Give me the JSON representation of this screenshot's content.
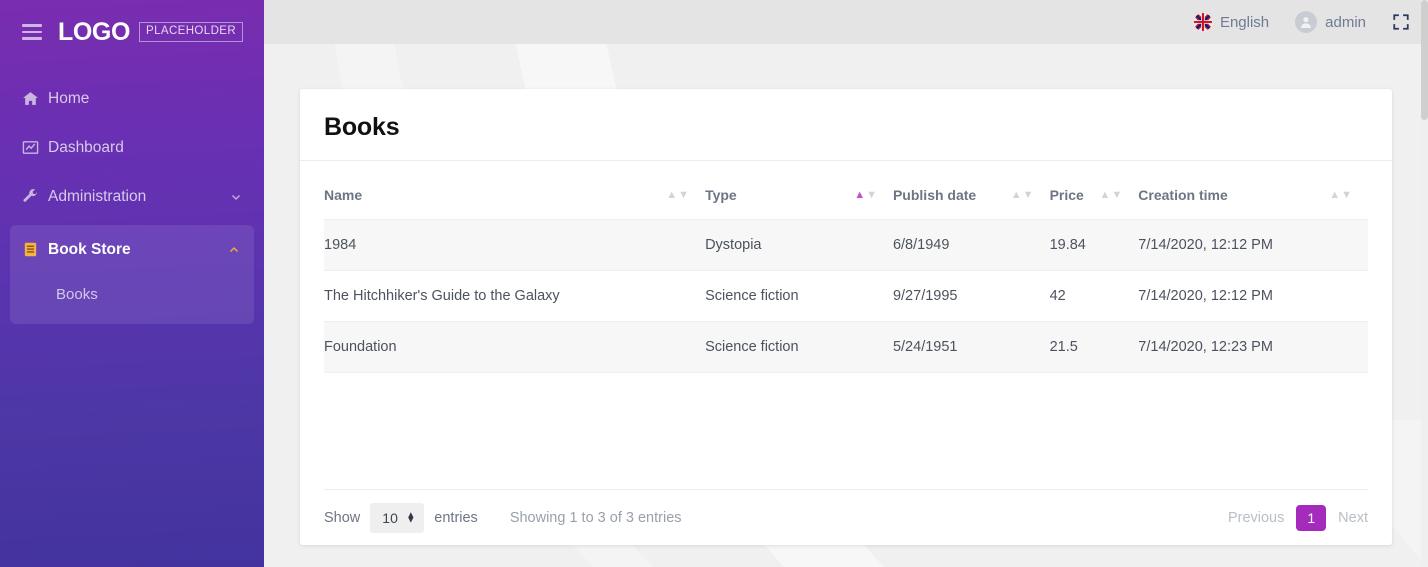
{
  "brand": {
    "logo_word": "LOGO",
    "logo_badge": "PLACEHOLDER",
    "menu_icon": "hamburger-icon"
  },
  "sidebar": {
    "items": [
      {
        "label": "Home",
        "icon": "home-icon"
      },
      {
        "label": "Dashboard",
        "icon": "chart-line-icon"
      },
      {
        "label": "Administration",
        "icon": "wrench-icon",
        "caret": "chevron-down-icon"
      }
    ],
    "group": {
      "label": "Book Store",
      "icon": "book-icon",
      "caret": "chevron-up-icon",
      "children": [
        {
          "label": "Books"
        }
      ]
    }
  },
  "topbar": {
    "language": "English",
    "language_icon": "uk-flag-icon",
    "user": "admin",
    "user_icon": "avatar-icon",
    "fullscreen_icon": "fullscreen-icon"
  },
  "page": {
    "title": "Books"
  },
  "table": {
    "columns": [
      {
        "label": "Name",
        "sort": "none"
      },
      {
        "label": "Type",
        "sort": "asc"
      },
      {
        "label": "Publish date",
        "sort": "none"
      },
      {
        "label": "Price",
        "sort": "none"
      },
      {
        "label": "Creation time",
        "sort": "none"
      }
    ],
    "rows": [
      {
        "name": "1984",
        "type": "Dystopia",
        "publish_date": "6/8/1949",
        "price": "19.84",
        "creation_time": "7/14/2020, 12:12 PM"
      },
      {
        "name": "The Hitchhiker's Guide to the Galaxy",
        "type": "Science fiction",
        "publish_date": "9/27/1995",
        "price": "42",
        "creation_time": "7/14/2020, 12:12 PM"
      },
      {
        "name": "Foundation",
        "type": "Science fiction",
        "publish_date": "5/24/1951",
        "price": "21.5",
        "creation_time": "7/14/2020, 12:23 PM"
      }
    ]
  },
  "footer": {
    "show_label": "Show",
    "page_length": "10",
    "entries_label": "entries",
    "info": "Showing 1 to 3 of 3 entries",
    "previous": "Previous",
    "current_page": "1",
    "next": "Next"
  },
  "colors": {
    "sidebar_top": "#7a2daf",
    "sidebar_bottom": "#43339f",
    "accent": "#a52bbd",
    "active_sort": "#c44fd0",
    "book_icon": "#f5b342",
    "topbar_bg": "#e4e4e4",
    "page_bg": "#f0f0f0"
  }
}
